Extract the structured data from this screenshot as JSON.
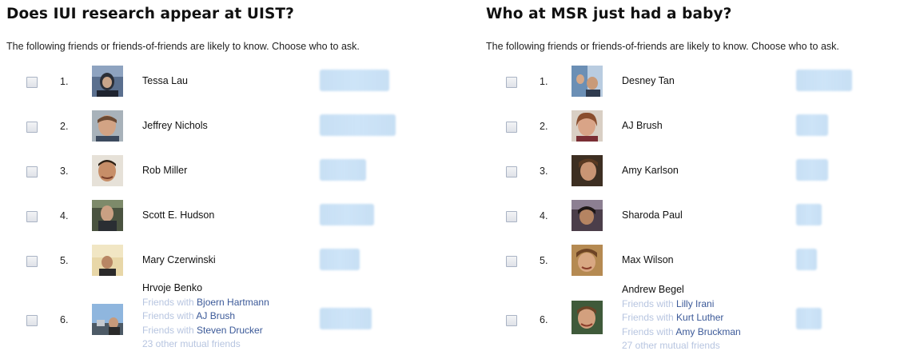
{
  "left": {
    "title": "Does IUI research appear at UIST?",
    "subtitle": "The following friends or friends-of-friends are likely to know. Choose who to ask.",
    "rows": [
      {
        "num": "1.",
        "name": "Tessa Lau"
      },
      {
        "num": "2.",
        "name": "Jeffrey Nichols"
      },
      {
        "num": "3.",
        "name": "Rob Miller"
      },
      {
        "num": "4.",
        "name": "Scott E. Hudson"
      },
      {
        "num": "5.",
        "name": "Mary Czerwinski"
      }
    ],
    "row6": {
      "num": "6.",
      "name": "Hrvoje Benko",
      "friends_prefix": "Friends with",
      "friends": [
        "Bjoern Hartmann",
        "AJ Brush",
        "Steven Drucker"
      ],
      "mutual": "23 other mutual friends"
    }
  },
  "right": {
    "title": "Who at MSR just had a baby?",
    "subtitle": "The following friends or friends-of-friends are likely to know. Choose who to ask.",
    "rows": [
      {
        "num": "1.",
        "name": "Desney Tan"
      },
      {
        "num": "2.",
        "name": "AJ Brush"
      },
      {
        "num": "3.",
        "name": "Amy Karlson"
      },
      {
        "num": "4.",
        "name": "Sharoda Paul"
      },
      {
        "num": "5.",
        "name": "Max Wilson"
      }
    ],
    "row6": {
      "num": "6.",
      "name": "Andrew Begel",
      "friends_prefix": "Friends with",
      "friends": [
        "Lilly Irani",
        "Kurt Luther",
        "Amy Bruckman"
      ],
      "mutual": "27 other mutual friends"
    }
  }
}
